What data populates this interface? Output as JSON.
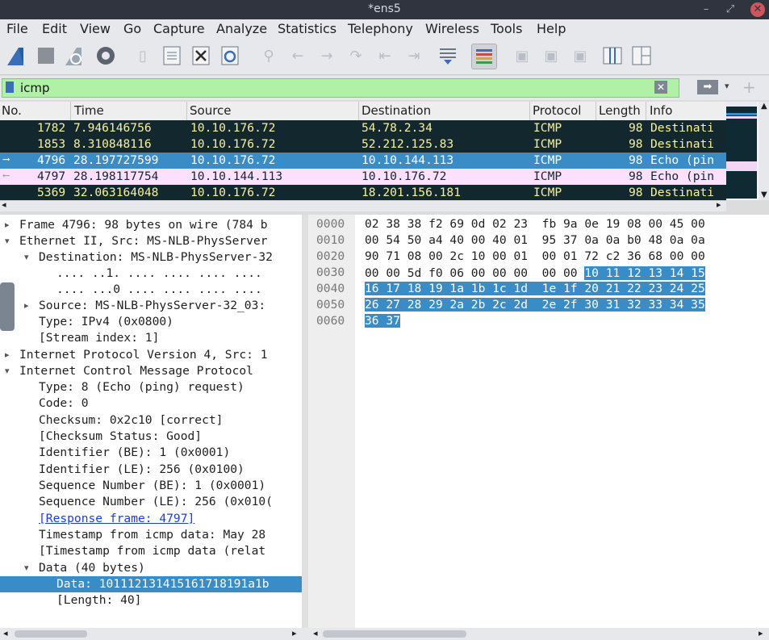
{
  "window": {
    "title": "*ens5"
  },
  "menu": [
    "File",
    "Edit",
    "View",
    "Go",
    "Capture",
    "Analyze",
    "Statistics",
    "Telephony",
    "Wireless",
    "Tools",
    "Help"
  ],
  "filter": {
    "value": "icmp"
  },
  "packet_list": {
    "columns": [
      "No.",
      "Time",
      "Source",
      "Destination",
      "Protocol",
      "Length",
      "Info"
    ],
    "rows": [
      {
        "no": "1782",
        "time": "7.946146756",
        "src": "10.10.176.72",
        "dst": "54.78.2.34",
        "proto": "ICMP",
        "len": "98",
        "info": "Destinati"
      },
      {
        "no": "1853",
        "time": "8.310848116",
        "src": "10.10.176.72",
        "dst": "52.212.125.83",
        "proto": "ICMP",
        "len": "98",
        "info": "Destinati"
      },
      {
        "no": "4796",
        "time": "28.197727599",
        "src": "10.10.176.72",
        "dst": "10.10.144.113",
        "proto": "ICMP",
        "len": "98",
        "info": "Echo (pin"
      },
      {
        "no": "4797",
        "time": "28.198117754",
        "src": "10.10.144.113",
        "dst": "10.10.176.72",
        "proto": "ICMP",
        "len": "98",
        "info": "Echo (pin"
      },
      {
        "no": "5369",
        "time": "32.063164048",
        "src": "10.10.176.72",
        "dst": "18.201.156.181",
        "proto": "ICMP",
        "len": "98",
        "info": "Destinati"
      }
    ]
  },
  "details": [
    "Frame 4796: 98 bytes on wire (784 b",
    "Ethernet II, Src: MS-NLB-PhysServer",
    "Destination: MS-NLB-PhysServer-32",
    ".... ..1. .... .... .... ....",
    ".... ...0 .... .... .... ....",
    "Source: MS-NLB-PhysServer-32_03:",
    "Type: IPv4 (0x0800)",
    "[Stream index: 1]",
    "Internet Protocol Version 4, Src: 1",
    "Internet Control Message Protocol",
    "Type: 8 (Echo (ping) request)",
    "Code: 0",
    "Checksum: 0x2c10 [correct]",
    "[Checksum Status: Good]",
    "Identifier (BE): 1 (0x0001)",
    "Identifier (LE): 256 (0x0100)",
    "Sequence Number (BE): 1 (0x0001)",
    "Sequence Number (LE): 256 (0x010(",
    "[Response frame: 4797]",
    "Timestamp from icmp data: May 28",
    "[Timestamp from icmp data (relat",
    "Data (40 bytes)",
    "Data: 101112131415161718191a1b",
    "[Length: 40]"
  ],
  "bytes": {
    "offsets": [
      "0000",
      "0010",
      "0020",
      "0030",
      "0040",
      "0050",
      "0060"
    ],
    "row0": "02 38 38 f2 69 0d 02 23  fb 9a 0e 19 08 00 45 00",
    "row1": "00 54 50 a4 40 00 40 01  95 37 0a 0a b0 48 0a 0a",
    "row2": "90 71 08 00 2c 10 00 01  00 01 72 c2 36 68 00 00",
    "row3_plain": "00 00 5d f0 06 00 00 00  00 00 ",
    "row3_hl": "10 11 12 13 14 15",
    "row4": "16 17 18 19 1a 1b 1c 1d  1e 1f 20 21 22 23 24 25",
    "row5": "26 27 28 29 2a 2b 2c 2d  2e 2f 30 31 32 33 34 35",
    "row6": "36 37"
  }
}
